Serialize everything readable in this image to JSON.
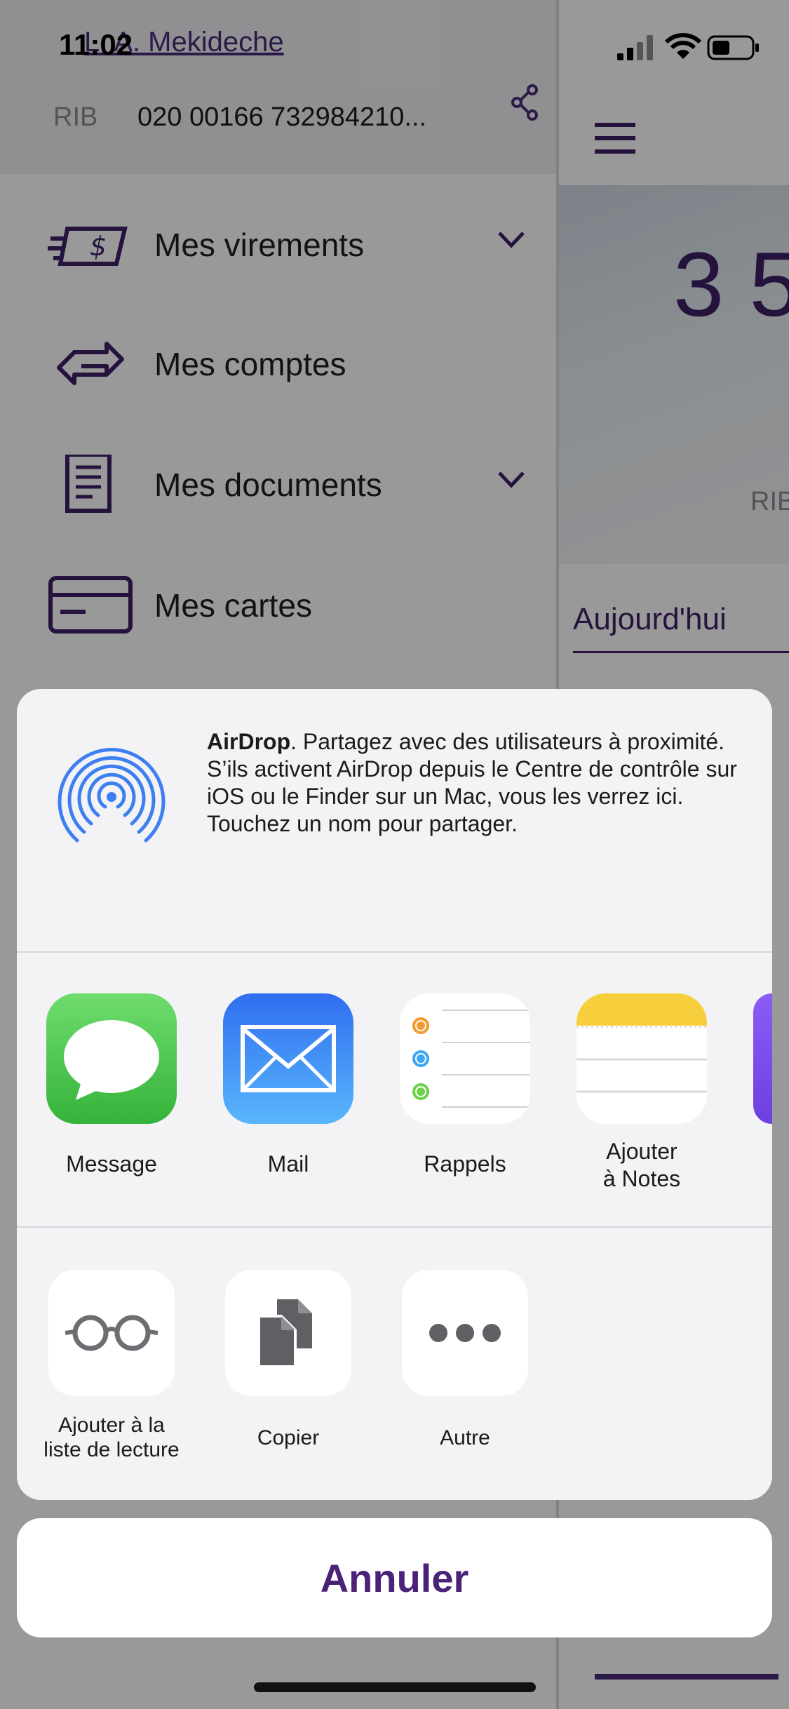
{
  "status_bar": {
    "time": "11:02"
  },
  "drawer": {
    "user_name": "L. A. Mekideche",
    "rib_label": "RIB",
    "rib_value": "020 00166 732984210...",
    "menu": [
      {
        "label": "Mes virements",
        "icon": "transfer-money-icon",
        "expandable": true
      },
      {
        "label": "Mes comptes",
        "icon": "accounts-arrows-icon",
        "expandable": false
      },
      {
        "label": "Mes documents",
        "icon": "document-icon",
        "expandable": true
      },
      {
        "label": "Mes cartes",
        "icon": "card-icon",
        "expandable": false
      }
    ]
  },
  "main": {
    "balance_partial": "3 5",
    "rib_label_partial": "RIB",
    "today_label": "Aujourd'hui"
  },
  "share_sheet": {
    "airdrop_title": "AirDrop",
    "airdrop_description": ". Partagez avec des utilisateurs à proximité. S’ils activent AirDrop depuis le Centre de contrôle sur iOS ou le Finder sur un Mac, vous les verrez ici. Touchez un nom pour partager.",
    "apps": [
      {
        "label": "Message",
        "icon": "messages-app-icon"
      },
      {
        "label": "Mail",
        "icon": "mail-app-icon"
      },
      {
        "label": "Rappels",
        "icon": "reminders-app-icon"
      },
      {
        "label": "Ajouter\nà Notes",
        "icon": "notes-app-icon"
      }
    ],
    "actions": [
      {
        "label": "Ajouter à la\nliste de lecture",
        "icon": "glasses-icon"
      },
      {
        "label": "Copier",
        "icon": "copy-icon"
      },
      {
        "label": "Autre",
        "icon": "more-icon"
      }
    ],
    "cancel_label": "Annuler"
  },
  "colors": {
    "brand_purple": "#4a2277",
    "airdrop_blue": "#3d7ff0",
    "messages_green": "#48c44a",
    "mail_blue": "#3a86f5",
    "notes_yellow": "#f7cf3c"
  }
}
